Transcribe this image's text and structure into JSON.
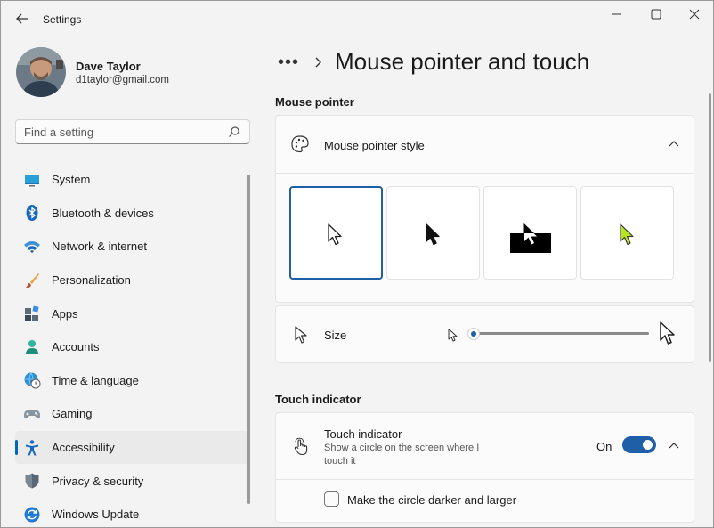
{
  "app": {
    "title": "Settings"
  },
  "user": {
    "name": "Dave Taylor",
    "email": "d1taylor@gmail.com"
  },
  "search": {
    "placeholder": "Find a setting"
  },
  "nav": {
    "items": [
      {
        "label": "System",
        "icon": "system-icon"
      },
      {
        "label": "Bluetooth & devices",
        "icon": "bluetooth-icon"
      },
      {
        "label": "Network & internet",
        "icon": "wifi-icon"
      },
      {
        "label": "Personalization",
        "icon": "brush-icon"
      },
      {
        "label": "Apps",
        "icon": "apps-icon"
      },
      {
        "label": "Accounts",
        "icon": "accounts-icon"
      },
      {
        "label": "Time & language",
        "icon": "globe-clock-icon"
      },
      {
        "label": "Gaming",
        "icon": "gamepad-icon"
      },
      {
        "label": "Accessibility",
        "icon": "accessibility-icon",
        "active": true
      },
      {
        "label": "Privacy & security",
        "icon": "shield-icon"
      },
      {
        "label": "Windows Update",
        "icon": "update-icon"
      }
    ]
  },
  "breadcrumb": {
    "more": "•••",
    "title": "Mouse pointer and touch"
  },
  "mouse_pointer": {
    "section_title": "Mouse pointer",
    "style_label": "Mouse pointer style",
    "styles": [
      "white",
      "black",
      "inverted",
      "custom"
    ],
    "selected_style": "white",
    "size_label": "Size",
    "size_value_fraction": 0.0
  },
  "touch": {
    "section_title": "Touch indicator",
    "label": "Touch indicator",
    "description_line1": "Show a circle on the screen where I",
    "description_line2": "touch it",
    "toggle_state": "On",
    "checkbox_label": "Make the circle darker and larger",
    "checkbox_checked": false
  },
  "colors": {
    "accent": "#1f5fa8",
    "custom_pointer": "#b5e61d"
  }
}
